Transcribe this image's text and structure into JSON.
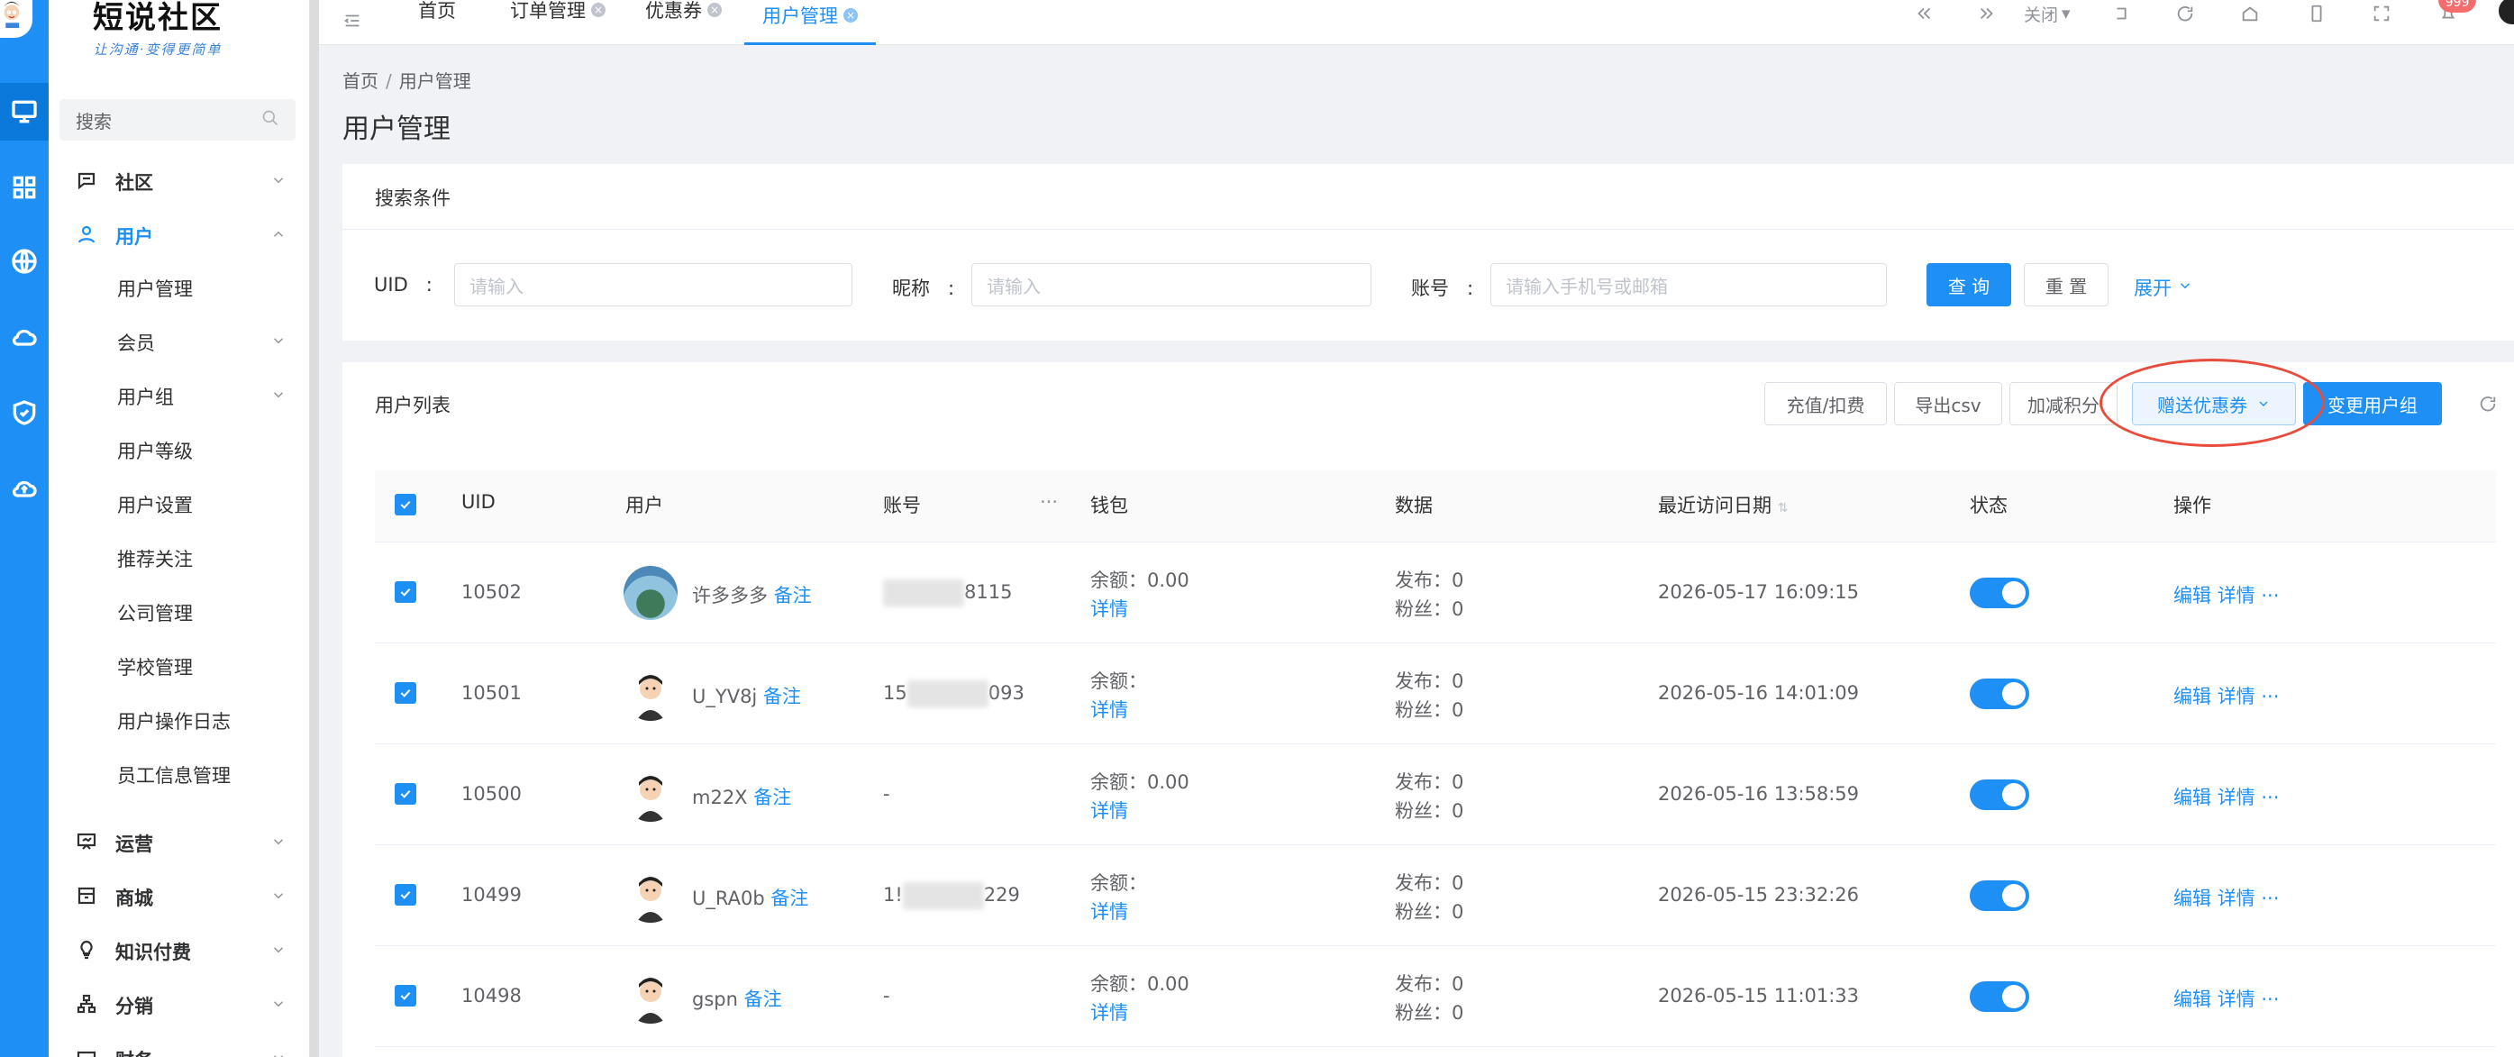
{
  "logo": {
    "title": "短说社区",
    "subtitle": "让沟通·变得更简单"
  },
  "sidebar": {
    "search_placeholder": "搜索",
    "groups": [
      {
        "label": "社区"
      },
      {
        "label": "用户"
      },
      {
        "label": "运营"
      },
      {
        "label": "商城"
      },
      {
        "label": "知识付费"
      },
      {
        "label": "分销"
      },
      {
        "label": "财务"
      }
    ],
    "user_sub": [
      {
        "label": "用户管理"
      },
      {
        "label": "会员"
      },
      {
        "label": "用户组"
      },
      {
        "label": "用户等级"
      },
      {
        "label": "用户设置"
      },
      {
        "label": "推荐关注"
      },
      {
        "label": "公司管理"
      },
      {
        "label": "学校管理"
      },
      {
        "label": "用户操作日志"
      },
      {
        "label": "员工信息管理"
      }
    ]
  },
  "tabs": [
    {
      "label": "首页"
    },
    {
      "label": "订单管理"
    },
    {
      "label": "优惠券"
    },
    {
      "label": "用户管理"
    }
  ],
  "topbar": {
    "close_label": "关闭",
    "badge": "999"
  },
  "breadcrumb": {
    "home": "首页",
    "current": "用户管理"
  },
  "page_title": "用户管理",
  "search_card": {
    "title": "搜索条件",
    "uid_label": "UID",
    "uid_placeholder": "请输入",
    "nickname_label": "昵称",
    "nickname_placeholder": "请输入",
    "account_label": "账号",
    "account_placeholder": "请输入手机号或邮箱",
    "query": "查 询",
    "reset": "重 置",
    "expand": "展开"
  },
  "list_card": {
    "title": "用户列表",
    "btn_recharge": "充值/扣费",
    "btn_export": "导出csv",
    "btn_points": "加减积分",
    "btn_coupon": "赠送优惠券",
    "btn_change_group": "变更用户组"
  },
  "table": {
    "headers": {
      "uid": "UID",
      "user": "用户",
      "account": "账号",
      "more": "···",
      "wallet": "钱包",
      "data": "数据",
      "last_visit": "最近访问日期",
      "status": "状态",
      "actions": "操作"
    },
    "note_label": "备注",
    "balance_label": "余额：",
    "detail_label": "详情",
    "publish_label": "发布：",
    "fans_label": "粉丝：",
    "edit_label": "编辑",
    "details_label": "详情",
    "more_label": "···",
    "rows": [
      {
        "uid": "10502",
        "name": "许多多多",
        "account_suffix": "8115",
        "account_prefix": "",
        "balance": "0.00",
        "publish": "0",
        "fans": "0",
        "date": "2026-05-17 16:09:15"
      },
      {
        "uid": "10501",
        "name": "U_YV8j",
        "account_suffix": "093",
        "account_prefix": "15",
        "balance": "",
        "publish": "0",
        "fans": "0",
        "date": "2026-05-16 14:01:09"
      },
      {
        "uid": "10500",
        "name": "m22X",
        "account_suffix": "-",
        "account_prefix": "",
        "balance": "0.00",
        "publish": "0",
        "fans": "0",
        "date": "2026-05-16 13:58:59"
      },
      {
        "uid": "10499",
        "name": "U_RA0b",
        "account_suffix": "229",
        "account_prefix": "1!",
        "balance": "",
        "publish": "0",
        "fans": "0",
        "date": "2026-05-15 23:32:26"
      },
      {
        "uid": "10498",
        "name": "gspn",
        "account_suffix": "-",
        "account_prefix": "",
        "balance": "0.00",
        "publish": "0",
        "fans": "0",
        "date": "2026-05-15 11:01:33"
      }
    ]
  },
  "colors": {
    "primary": "#1e8ff5",
    "danger": "#f56c6c",
    "highlight": "#e74c3c"
  }
}
